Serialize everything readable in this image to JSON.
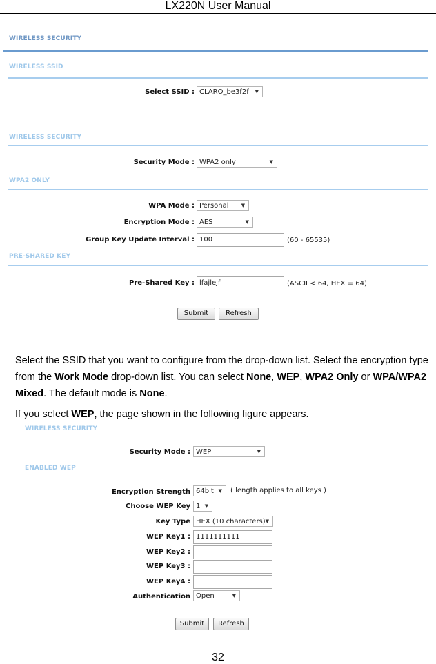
{
  "header": {
    "title": "LX220N User Manual"
  },
  "figure1": {
    "page_title": "WIRELESS SECURITY",
    "ssid_section": {
      "title": "WIRELESS SSID",
      "select_ssid_label": "Select SSID :",
      "select_ssid_value": "CLARO_be3f2f"
    },
    "security_section": {
      "title": "WIRELESS SECURITY",
      "security_mode_label": "Security Mode :",
      "security_mode_value": "WPA2 only"
    },
    "wpa2_section": {
      "title": "WPA2 ONLY",
      "wpa_mode_label": "WPA Mode :",
      "wpa_mode_value": "Personal",
      "encryption_mode_label": "Encryption Mode :",
      "encryption_mode_value": "AES",
      "group_key_label": "Group Key Update Interval :",
      "group_key_value": "100",
      "group_key_hint": "(60 - 65535)"
    },
    "psk_section": {
      "title": "PRE-SHARED KEY",
      "psk_label": "Pre-Shared Key :",
      "psk_value": "lfajlejf",
      "psk_hint": "(ASCII < 64, HEX = 64)"
    },
    "buttons": {
      "submit": "Submit",
      "refresh": "Refresh"
    }
  },
  "body_text": {
    "p1_a": "Select the SSID that you want to configure from the drop-down list. Select the encryption type from the ",
    "p1_b": "Work Mode",
    "p1_c": " drop-down list. You can select ",
    "p1_d": "None",
    "p1_e": ", ",
    "p1_f": "WEP",
    "p1_g": ", ",
    "p1_h": "WPA2 Only",
    "p1_i": " or ",
    "p1_j": "WPA/WPA2 Mixed",
    "p1_k": ". The default mode is ",
    "p1_l": "None",
    "p1_m": ".",
    "p2_a": "If you select ",
    "p2_b": "WEP",
    "p2_c": ", the page shown in the following figure appears."
  },
  "figure2": {
    "security_section": {
      "title": "WIRELESS SECURITY",
      "security_mode_label": "Security Mode :",
      "security_mode_value": "WEP"
    },
    "wep_section": {
      "title": "ENABLED WEP",
      "strength_label": "Encryption Strength",
      "strength_value": "64bit",
      "strength_hint": "( length applies to all keys )",
      "choose_key_label": "Choose WEP Key",
      "choose_key_value": "1",
      "key_type_label": "Key Type",
      "key_type_value": "HEX (10 characters)",
      "key1_label": "WEP Key1 :",
      "key1_value": "1111111111",
      "key2_label": "WEP Key2 :",
      "key2_value": "",
      "key3_label": "WEP Key3 :",
      "key3_value": "",
      "key4_label": "WEP Key4 :",
      "key4_value": "",
      "auth_label": "Authentication",
      "auth_value": "Open"
    },
    "buttons": {
      "submit": "Submit",
      "refresh": "Refresh"
    }
  },
  "colors": {
    "primary_title": "#6f97c4",
    "secondary_title": "#9fc8ea",
    "primary_rule": "#6a9bcf",
    "secondary_rule": "#a7cdee"
  },
  "icons": {
    "dropdown": "chevron-down-icon"
  },
  "footer": {
    "page_number": "32"
  }
}
